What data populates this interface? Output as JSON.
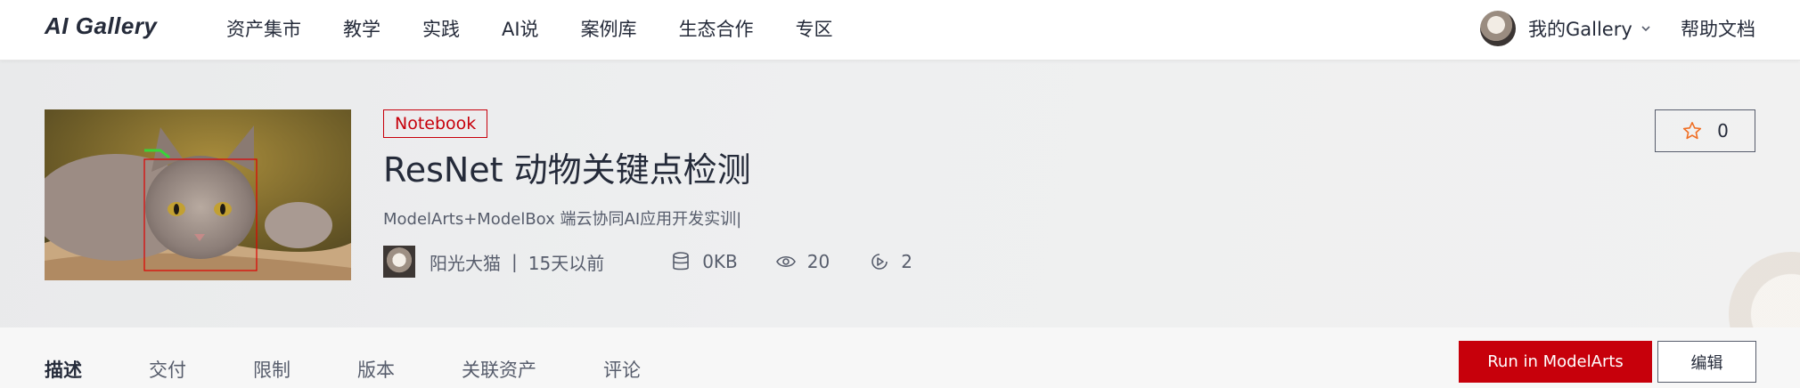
{
  "header": {
    "logo": "AI Gallery",
    "nav": [
      "资产集市",
      "教学",
      "实践",
      "AI说",
      "案例库",
      "生态合作",
      "专区"
    ],
    "user_label": "我的Gallery",
    "user_chevron_icon": "chevron-down-icon",
    "help_label": "帮助文档"
  },
  "asset": {
    "tag": "Notebook",
    "title": "ResNet 动物关键点检测",
    "subtitle": "ModelArts+ModelBox 端云协同AI应用开发实训|",
    "author": "阳光大猫",
    "separator": "|",
    "time": "15天以前",
    "size": "0KB",
    "views": "20",
    "runs": "2",
    "favorites": "0",
    "icons": {
      "size": "database-icon",
      "views": "eye-icon",
      "runs": "play-circle-icon",
      "favorite": "star-icon"
    }
  },
  "tabs": [
    {
      "label": "描述",
      "active": true
    },
    {
      "label": "交付",
      "active": false
    },
    {
      "label": "限制",
      "active": false
    },
    {
      "label": "版本",
      "active": false
    },
    {
      "label": "关联资产",
      "active": false
    },
    {
      "label": "评论",
      "active": false
    }
  ],
  "actions": {
    "run_label": "Run in ModelArts",
    "edit_label": "编辑"
  },
  "colors": {
    "brand_red": "#c7000b",
    "text_dark": "#252b3a",
    "text_muted": "#575d6c",
    "star_orange": "#f06e23"
  }
}
